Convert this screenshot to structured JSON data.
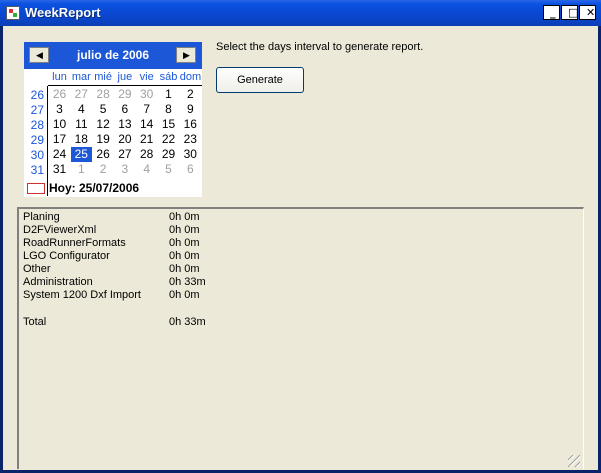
{
  "window": {
    "title": "WeekReport",
    "controls": {
      "minimize": "_",
      "maximize": "□",
      "close": "✕"
    }
  },
  "calendar": {
    "month_title": "julio de 2006",
    "prev_icon": "◀",
    "next_icon": "▶",
    "weekdays": [
      "lun",
      "mar",
      "mié",
      "jue",
      "vie",
      "sáb",
      "dom"
    ],
    "weeks": [
      {
        "num": "26",
        "days": [
          {
            "d": "26",
            "other": true
          },
          {
            "d": "27",
            "other": true
          },
          {
            "d": "28",
            "other": true
          },
          {
            "d": "29",
            "other": true
          },
          {
            "d": "30",
            "other": true
          },
          {
            "d": "1"
          },
          {
            "d": "2"
          }
        ]
      },
      {
        "num": "27",
        "days": [
          {
            "d": "3"
          },
          {
            "d": "4"
          },
          {
            "d": "5"
          },
          {
            "d": "6"
          },
          {
            "d": "7"
          },
          {
            "d": "8"
          },
          {
            "d": "9"
          }
        ]
      },
      {
        "num": "28",
        "days": [
          {
            "d": "10"
          },
          {
            "d": "11"
          },
          {
            "d": "12"
          },
          {
            "d": "13"
          },
          {
            "d": "14"
          },
          {
            "d": "15"
          },
          {
            "d": "16"
          }
        ]
      },
      {
        "num": "29",
        "days": [
          {
            "d": "17"
          },
          {
            "d": "18"
          },
          {
            "d": "19"
          },
          {
            "d": "20"
          },
          {
            "d": "21"
          },
          {
            "d": "22"
          },
          {
            "d": "23"
          }
        ]
      },
      {
        "num": "30",
        "days": [
          {
            "d": "24"
          },
          {
            "d": "25",
            "selected": true
          },
          {
            "d": "26"
          },
          {
            "d": "27"
          },
          {
            "d": "28"
          },
          {
            "d": "29"
          },
          {
            "d": "30"
          }
        ]
      },
      {
        "num": "31",
        "days": [
          {
            "d": "31"
          },
          {
            "d": "1",
            "other": true
          },
          {
            "d": "2",
            "other": true
          },
          {
            "d": "3",
            "other": true
          },
          {
            "d": "4",
            "other": true
          },
          {
            "d": "5",
            "other": true
          },
          {
            "d": "6",
            "other": true
          }
        ]
      }
    ],
    "today_label": "Hoy: 25/07/2006"
  },
  "instructions": "Select the days interval to generate report.",
  "generate_label": "Generate",
  "report": {
    "rows": [
      {
        "name": "Planing",
        "time": "0h 0m"
      },
      {
        "name": "D2FViewerXml",
        "time": "0h 0m"
      },
      {
        "name": "RoadRunnerFormats",
        "time": "0h 0m"
      },
      {
        "name": "LGO Configurator",
        "time": "0h 0m"
      },
      {
        "name": "Other",
        "time": "0h 0m"
      },
      {
        "name": "Administration",
        "time": "0h 33m"
      },
      {
        "name": "System 1200 Dxf Import",
        "time": "0h 0m"
      }
    ],
    "total": {
      "name": "Total",
      "time": "0h 33m"
    }
  },
  "colors": {
    "title_bar": "#0b52e0",
    "calendar_accent": "#1c57d8",
    "window_bg": "#ece9d8"
  }
}
